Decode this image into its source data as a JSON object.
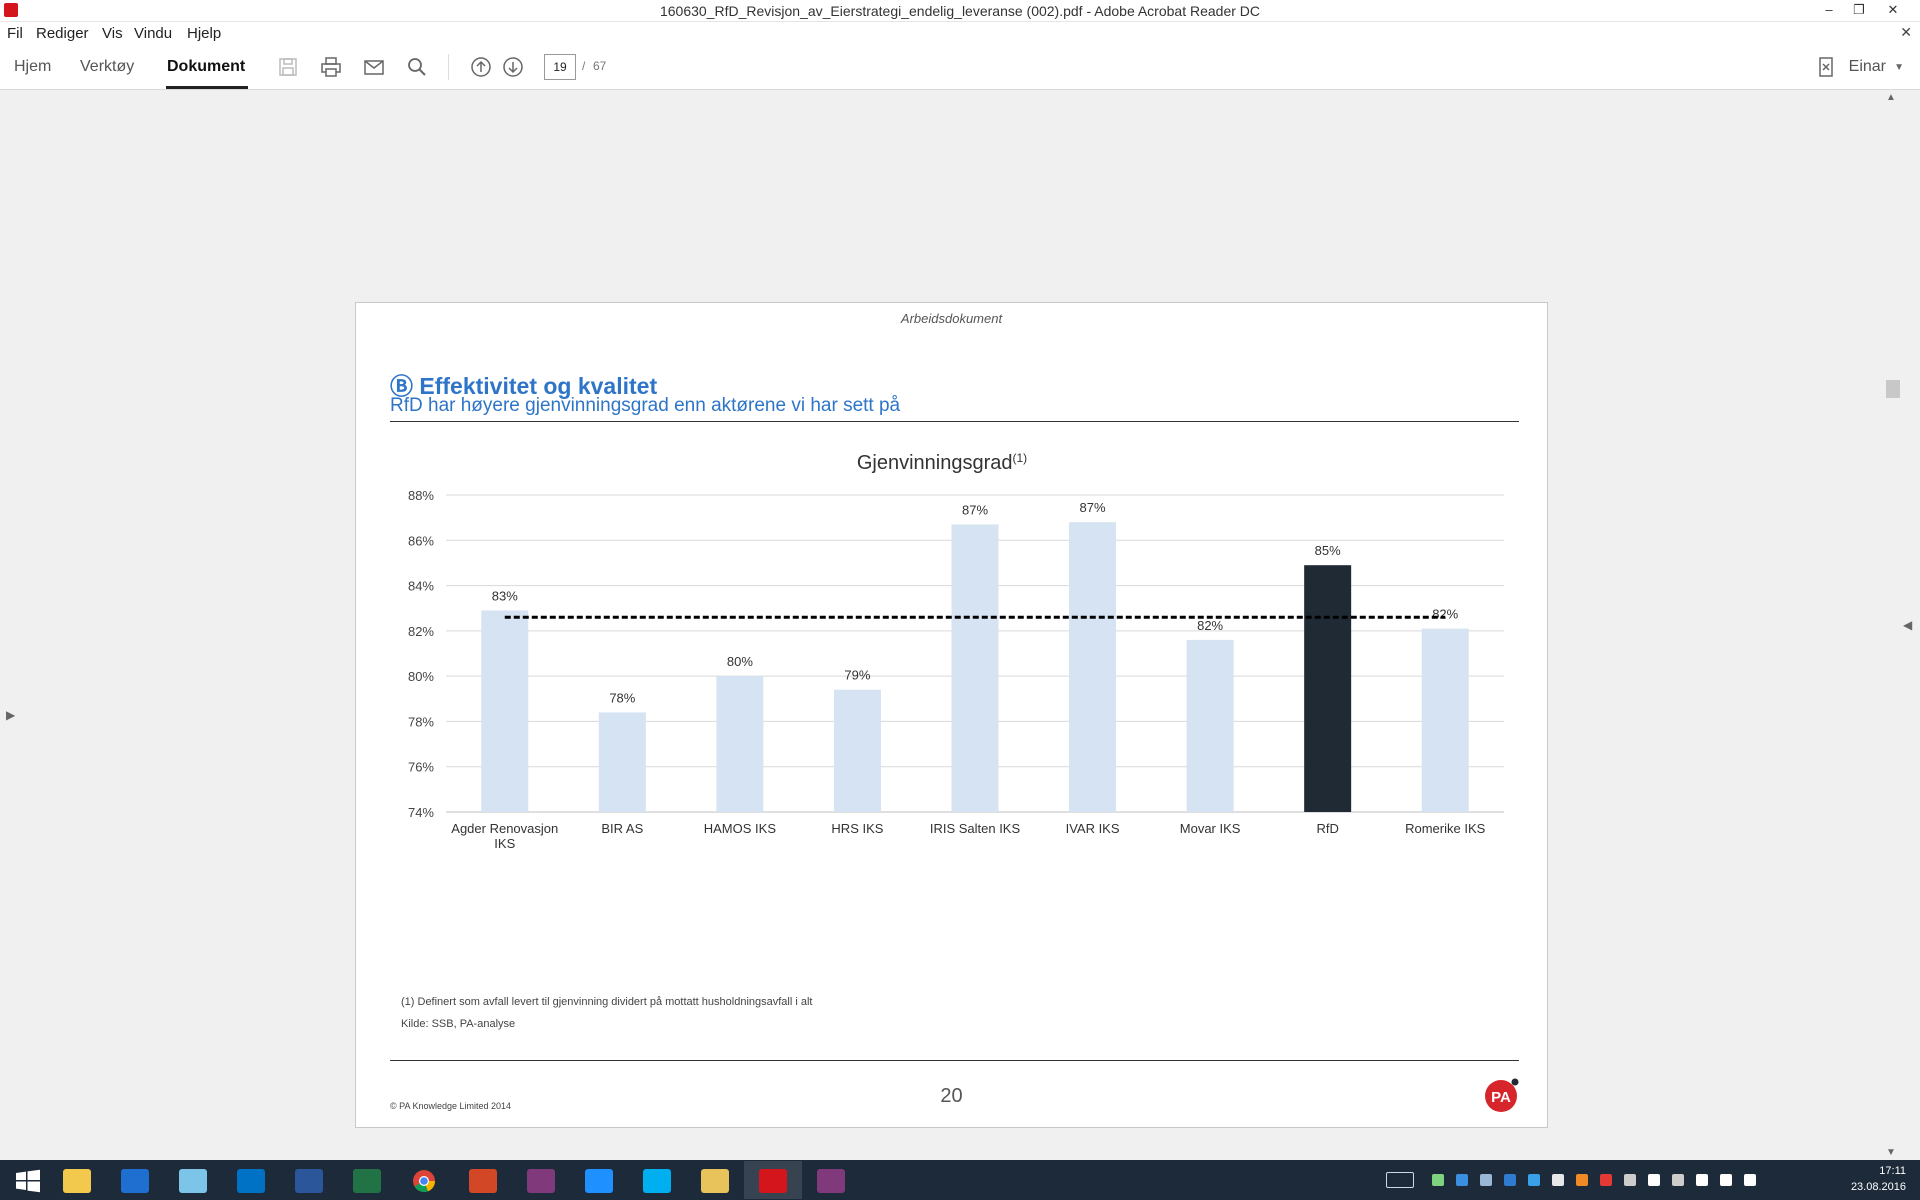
{
  "window": {
    "title": "160630_RfD_Revisjon_av_Eierstrategi_endelig_leveranse (002).pdf - Adobe Acrobat Reader DC"
  },
  "menu": [
    "Fil",
    "Rediger",
    "Vis",
    "Vindu",
    "Hjelp"
  ],
  "toolbar": {
    "tabs": [
      "Hjem",
      "Verktøy",
      "Dokument"
    ],
    "active_tab": "Dokument",
    "page_current": "19",
    "page_sep": "/",
    "page_total": "67",
    "user": "Einar"
  },
  "slide": {
    "watermark": "Arbeidsdokument",
    "title": "Ⓑ Effektivitet og kvalitet",
    "subtitle": "RfD har høyere gjenvinningsgrad enn aktørene vi har sett på",
    "footnote": "(1) Definert som avfall levert til gjenvinning dividert  på mottatt husholdningsavfall i alt",
    "source": "Kilde: SSB, PA-analyse",
    "copyright": "© PA Knowledge Limited 2014",
    "page_number": "20",
    "logo_text": "PA"
  },
  "chart_data": {
    "type": "bar",
    "title": "Gjenvinningsgrad",
    "title_superscript": "(1)",
    "categories": [
      "Agder Renovasjon IKS",
      "BIR AS",
      "HAMOS IKS",
      "HRS IKS",
      "IRIS Salten IKS",
      "IVAR IKS",
      "Movar IKS",
      "RfD",
      "Romerike IKS"
    ],
    "values": [
      82.9,
      78.4,
      80.0,
      79.4,
      86.7,
      86.8,
      81.6,
      84.9,
      82.1
    ],
    "data_labels": [
      "83%",
      "78%",
      "80%",
      "79%",
      "87%",
      "87%",
      "82%",
      "85%",
      "82%"
    ],
    "highlight_category": "RfD",
    "bar_color": "#d6e3f3",
    "highlight_color": "#1f2a35",
    "reference_line": 82.6,
    "ylim": [
      74,
      88
    ],
    "yticks": [
      74,
      76,
      78,
      80,
      82,
      84,
      86,
      88
    ],
    "ytick_labels": [
      "74%",
      "76%",
      "78%",
      "80%",
      "82%",
      "84%",
      "86%",
      "88%"
    ],
    "grid": true
  },
  "taskbar": {
    "apps": [
      "start",
      "file-explorer",
      "mail",
      "photos",
      "outlook",
      "word",
      "excel",
      "chrome",
      "powerpoint",
      "onenote",
      "internet-explorer",
      "skype",
      "files",
      "acrobat",
      "onenote-clipper"
    ],
    "active_app": "acrobat",
    "time": "17:11",
    "date": "23.08.2016"
  },
  "colors": {
    "accent_blue": "#2e75c8",
    "taskbar": "#1c2a3a"
  }
}
